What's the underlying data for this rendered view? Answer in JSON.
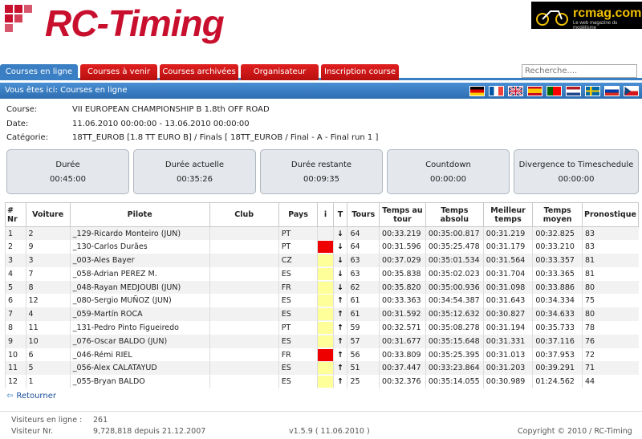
{
  "brand": {
    "logo_text": "RC-Timing",
    "banner_name": "rcmag.com",
    "banner_sub": "Le web magazine du modélisme"
  },
  "nav": {
    "tabs": [
      {
        "label": "Courses en ligne",
        "active": true
      },
      {
        "label": "Courses à venir",
        "active": false
      },
      {
        "label": "Courses archivées",
        "active": false
      },
      {
        "label": "Organisateur",
        "active": false
      },
      {
        "label": "Inscription course",
        "active": false
      }
    ],
    "search_placeholder": "Recherche...."
  },
  "breadcrumb": {
    "text": "Vous êtes ici: Courses en ligne"
  },
  "flags": [
    "germany-flag",
    "france-flag",
    "uk-flag",
    "spain-flag",
    "portugal-flag",
    "netherlands-flag",
    "sweden-flag",
    "russia-flag",
    "czech-flag"
  ],
  "race": {
    "course_label": "Course:",
    "course_value": "VII EUROPEAN CHAMPIONSHIP B 1.8th OFF ROAD",
    "date_label": "Date:",
    "date_value": "11.06.2010 00:00:00 - 13.06.2010 00:00:00",
    "category_label": "Catégorie:",
    "category_value": "18TT_EUROB [1.8 TT EURO B] / Finals [ 18TT_EUROB / Final - A - Final run 1 ]"
  },
  "timers": [
    {
      "title": "Durée",
      "value": "00:45:00"
    },
    {
      "title": "Durée actuelle",
      "value": "00:35:26"
    },
    {
      "title": "Durée restante",
      "value": "00:09:35"
    },
    {
      "title": "Countdown",
      "value": "00:00:00"
    },
    {
      "title": "Divergence to Timeschedule",
      "value": "00:00:00"
    }
  ],
  "table": {
    "headers": [
      "# Nr",
      "Voiture",
      "Pilote",
      "Club",
      "Pays",
      "i",
      "T",
      "Tours",
      "Temps au tour",
      "Temps absolu",
      "Meilleur temps",
      "Temps moyen",
      "Pronostique"
    ],
    "rows": [
      {
        "nr": "1",
        "car": "2",
        "pilot": "_129-Ricardo Monteiro (JUN)",
        "club": "",
        "country": "PT",
        "info": "",
        "trend": "↓",
        "laps": "64",
        "lap": "00:33.219",
        "abs": "00:35:00.817",
        "best": "00:31.219",
        "avg": "00:32.825",
        "prog": "83"
      },
      {
        "nr": "2",
        "car": "9",
        "pilot": "_130-Carlos Durães",
        "club": "",
        "country": "PT",
        "info": "red",
        "trend": "↓",
        "laps": "64",
        "lap": "00:31.596",
        "abs": "00:35:25.478",
        "best": "00:31.179",
        "avg": "00:33.210",
        "prog": "83"
      },
      {
        "nr": "3",
        "car": "3",
        "pilot": "_003-Ales Bayer",
        "club": "",
        "country": "CZ",
        "info": "yellow",
        "trend": "↓",
        "laps": "63",
        "lap": "00:37.029",
        "abs": "00:35:01.534",
        "best": "00:31.564",
        "avg": "00:33.357",
        "prog": "81"
      },
      {
        "nr": "4",
        "car": "7",
        "pilot": "_058-Adrian PEREZ M.",
        "club": "",
        "country": "ES",
        "info": "yellow",
        "trend": "↓",
        "laps": "63",
        "lap": "00:35.838",
        "abs": "00:35:02.023",
        "best": "00:31.704",
        "avg": "00:33.365",
        "prog": "81"
      },
      {
        "nr": "5",
        "car": "8",
        "pilot": "_048-Rayan MEDJOUBI (JUN)",
        "club": "",
        "country": "FR",
        "info": "yellow",
        "trend": "↓",
        "laps": "62",
        "lap": "00:35.820",
        "abs": "00:35:00.936",
        "best": "00:31.098",
        "avg": "00:33.886",
        "prog": "80"
      },
      {
        "nr": "6",
        "car": "12",
        "pilot": "_080-Sergio MUÑOZ (JUN)",
        "club": "",
        "country": "ES",
        "info": "yellow",
        "trend": "↑",
        "laps": "61",
        "lap": "00:33.363",
        "abs": "00:34:54.387",
        "best": "00:31.643",
        "avg": "00:34.334",
        "prog": "75"
      },
      {
        "nr": "7",
        "car": "4",
        "pilot": "_059-Martín ROCA",
        "club": "",
        "country": "ES",
        "info": "yellow",
        "trend": "↑",
        "laps": "61",
        "lap": "00:31.592",
        "abs": "00:35:12.632",
        "best": "00:30.827",
        "avg": "00:34.633",
        "prog": "80"
      },
      {
        "nr": "8",
        "car": "11",
        "pilot": "_131-Pedro Pinto Figueiredo",
        "club": "",
        "country": "PT",
        "info": "yellow",
        "trend": "↑",
        "laps": "59",
        "lap": "00:32.571",
        "abs": "00:35:08.278",
        "best": "00:31.194",
        "avg": "00:35.733",
        "prog": "78"
      },
      {
        "nr": "9",
        "car": "10",
        "pilot": "_076-Oscar BALDO (JUN)",
        "club": "",
        "country": "ES",
        "info": "yellow",
        "trend": "↑",
        "laps": "57",
        "lap": "00:31.677",
        "abs": "00:35:15.648",
        "best": "00:31.331",
        "avg": "00:37.116",
        "prog": "76"
      },
      {
        "nr": "10",
        "car": "6",
        "pilot": "_046-Rémi RIEL",
        "club": "",
        "country": "FR",
        "info": "red",
        "trend": "↑",
        "laps": "56",
        "lap": "00:33.809",
        "abs": "00:35:25.395",
        "best": "00:31.013",
        "avg": "00:37.953",
        "prog": "72"
      },
      {
        "nr": "11",
        "car": "5",
        "pilot": "_056-Alex CALATAYUD",
        "club": "",
        "country": "ES",
        "info": "yellow",
        "trend": "↑",
        "laps": "51",
        "lap": "00:37.447",
        "abs": "00:33:23.864",
        "best": "00:31.203",
        "avg": "00:39.291",
        "prog": "71"
      },
      {
        "nr": "12",
        "car": "1",
        "pilot": "_055-Bryan BALDO",
        "club": "",
        "country": "ES",
        "info": "yellow",
        "trend": "↑",
        "laps": "25",
        "lap": "00:32.376",
        "abs": "00:35:14.055",
        "best": "00:30.989",
        "avg": "01:24.562",
        "prog": "44"
      }
    ]
  },
  "back_label": "Retourner",
  "footer": {
    "visitors_online_label": "Visiteurs en ligne :",
    "visitors_online_value": "261",
    "visitor_nr_label": "Visiteur Nr.",
    "visitor_nr_value": "9,728,818 depuis 21.12.2007",
    "version": "v1.5.9 ( 11.06.2010 )",
    "copyright": "Copyright © 2010 / RC-Timing"
  },
  "colors": {
    "brand_red": "#c8102e",
    "nav_blue": "#3a7fc4",
    "info_red": "#ee0000",
    "info_yellow": "#ffff99"
  }
}
